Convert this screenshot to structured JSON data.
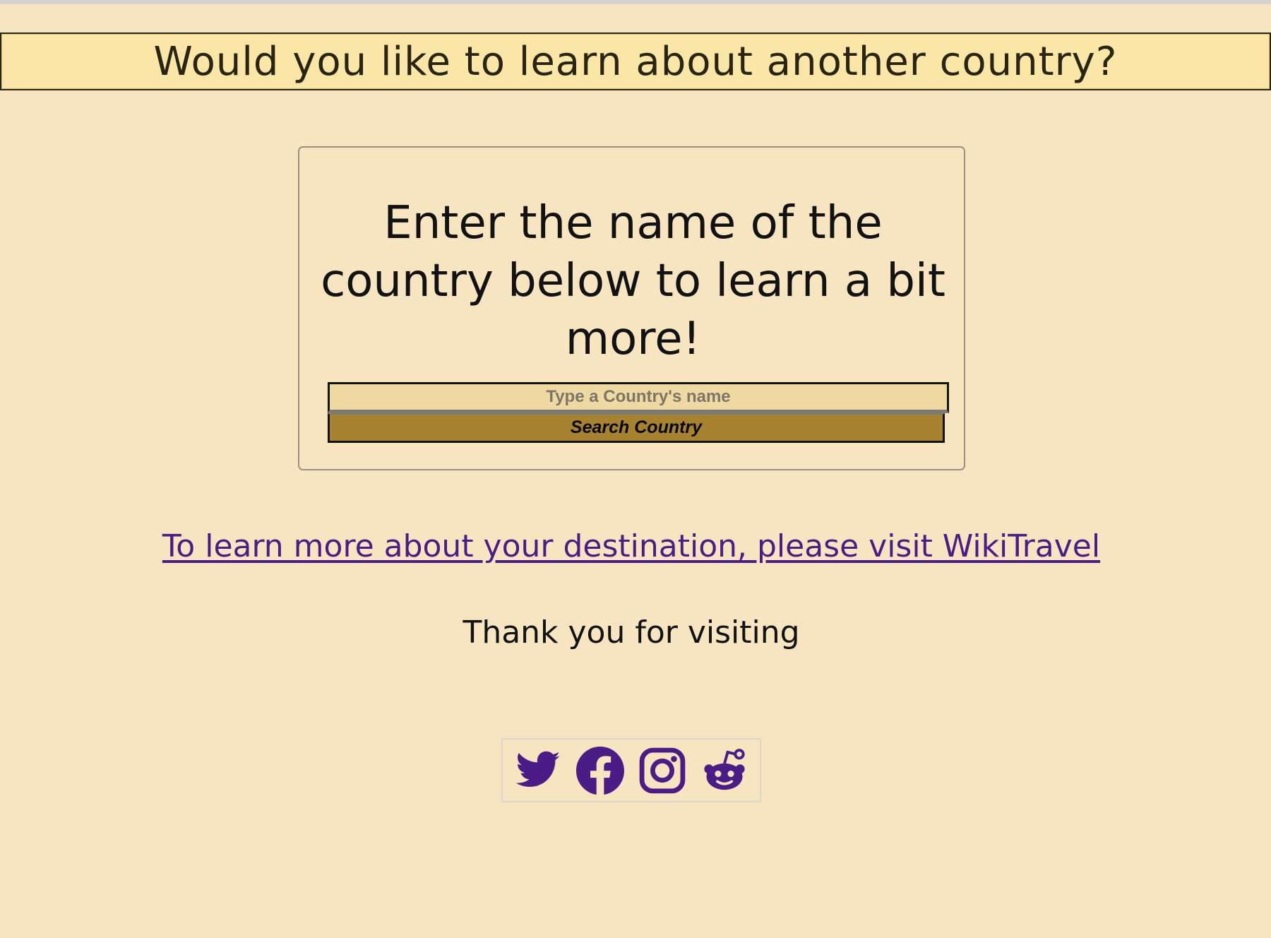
{
  "header": {
    "title": "Would you like to learn about another country?"
  },
  "search": {
    "heading": "Enter the name of the country below to learn a bit more!",
    "placeholder": "Type a Country's name",
    "button_label": "Search Country"
  },
  "links": {
    "wikitravel": "To learn more about your destination, please visit WikiTravel"
  },
  "footer": {
    "thanks": "Thank you for visiting",
    "social": [
      {
        "name": "Twitter",
        "icon": "twitter-icon"
      },
      {
        "name": "Facebook",
        "icon": "facebook-icon"
      },
      {
        "name": "Instagram",
        "icon": "instagram-icon"
      },
      {
        "name": "Reddit",
        "icon": "reddit-icon"
      }
    ]
  },
  "colors": {
    "background": "#f7e4c1",
    "banner": "#fae7a7",
    "button": "#a78230",
    "input": "#efd9a3",
    "link": "#4b1c86",
    "icon": "#4b1c86"
  }
}
